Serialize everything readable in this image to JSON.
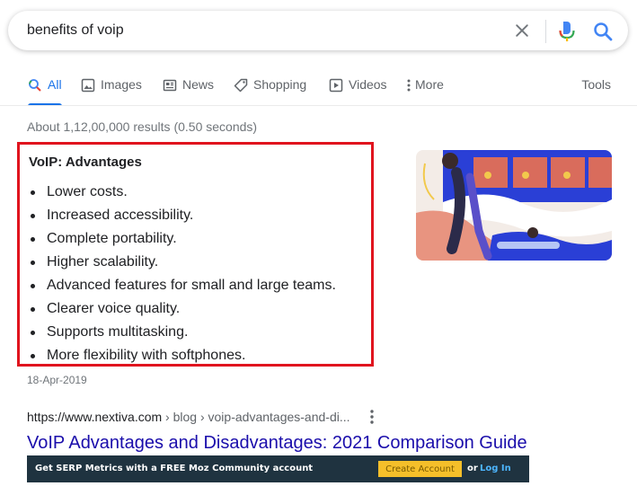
{
  "search": {
    "query": "benefits of voip"
  },
  "tabs": [
    {
      "label": "All",
      "icon": "search-icon"
    },
    {
      "label": "Images",
      "icon": "image-icon"
    },
    {
      "label": "News",
      "icon": "news-icon"
    },
    {
      "label": "Shopping",
      "icon": "tag-icon"
    },
    {
      "label": "Videos",
      "icon": "play-icon"
    },
    {
      "label": "More",
      "icon": "more-vert-icon"
    }
  ],
  "tools_label": "Tools",
  "results_stats": "About 1,12,00,000 results (0.50 seconds)",
  "snippet": {
    "title": "VoIP: Advantages",
    "items": [
      "Lower costs.",
      "Increased accessibility.",
      "Complete portability.",
      "Higher scalability.",
      "Advanced features for small and large teams.",
      "Clearer voice quality.",
      "Supports multitasking.",
      "More flexibility with softphones."
    ],
    "date": "18-Apr-2019"
  },
  "result": {
    "url_domain": "https://www.nextiva.com",
    "url_path": " › blog › voip-advantages-and-di...",
    "title": "VoIP Advantages and Disadvantages: 2021 Comparison Guide"
  },
  "moz": {
    "promo": "Get SERP Metrics with a FREE Moz Community account",
    "button": "Create Account",
    "or": "or",
    "login": "Log In"
  },
  "colors": {
    "accent": "#1a73e8",
    "highlight_border": "#e0141e",
    "link": "#1a0dab",
    "moz_bar": "#1f3340",
    "moz_button": "#f5bf2a"
  }
}
